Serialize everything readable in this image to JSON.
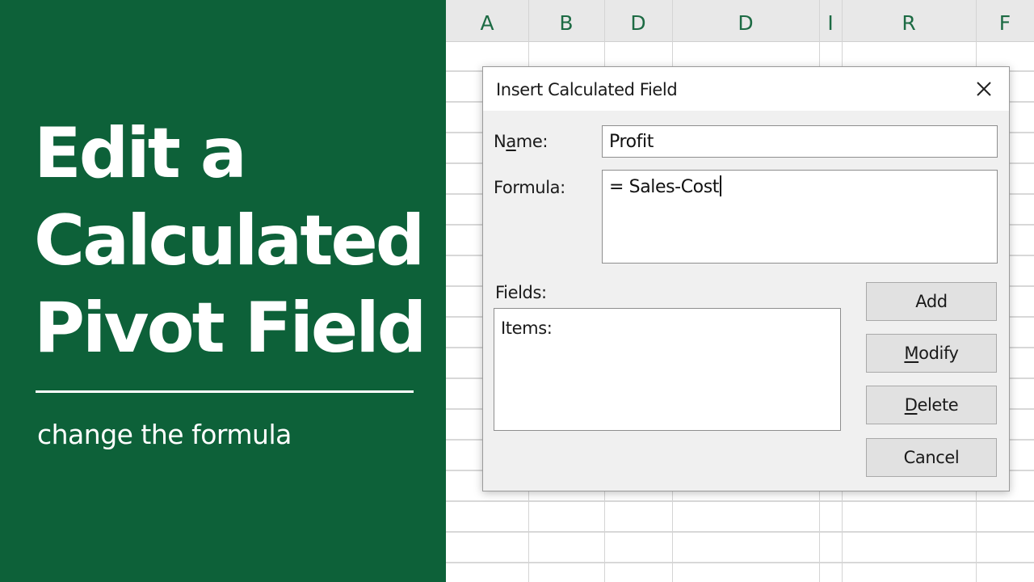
{
  "banner": {
    "title_lines": [
      "Edit a",
      "Calculated",
      "Pivot Field"
    ],
    "subtitle": "change the formula",
    "background_color": "#0d6139"
  },
  "sheet": {
    "column_headers": [
      "A",
      "B",
      "D",
      "D",
      "I",
      "R",
      "F"
    ]
  },
  "dialog": {
    "title": "Insert Calculated Field",
    "close_icon": "close-icon",
    "name_label": {
      "before": "N",
      "accel": "a",
      "after": "me:"
    },
    "name_value": "Profit",
    "formula_label": "Formula:",
    "formula_value": "= Sales-Cost",
    "fields_label": "Fields:",
    "fields_items": [
      "Items:"
    ],
    "buttons": {
      "add": {
        "before": "Add",
        "accel": "",
        "after": ""
      },
      "modify": {
        "before": "",
        "accel": "M",
        "after": "odify"
      },
      "delete": {
        "before": "",
        "accel": "D",
        "after": "elete"
      },
      "cancel": {
        "before": "Cancel",
        "accel": "",
        "after": ""
      }
    }
  }
}
